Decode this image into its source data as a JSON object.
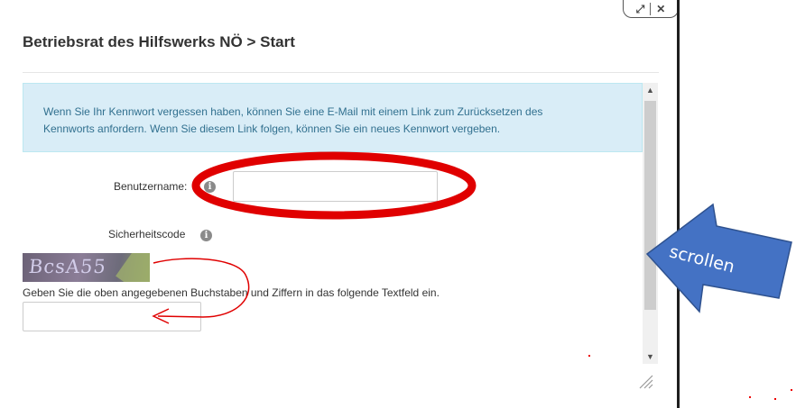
{
  "header": {
    "title": "Betriebsrat des Hilfswerks NÖ > Start",
    "controls": {
      "expand_icon": "⤢",
      "close_icon": "✕"
    }
  },
  "info": {
    "line1": "Wenn Sie Ihr Kennwort vergessen haben, können Sie eine E-Mail mit einem Link zum Zurücksetzen des",
    "line2": "Kennworts anfordern. Wenn Sie diesem Link folgen, können Sie ein neues Kennwort vergeben."
  },
  "form": {
    "username_label": "Benutzername:",
    "username_value": "",
    "security_label": "Sicherheitscode",
    "captcha_text": "BcsA55",
    "hint": "Geben Sie die oben angegebenen Buchstaben und Ziffern in das folgende Textfeld ein.",
    "code_value": "",
    "info_icon": "i"
  },
  "scrollbar": {
    "up_icon": "▲",
    "down_icon": "▼"
  },
  "annotation": {
    "arrow_text": "scrollen",
    "arrow_color": "#4472c4",
    "ellipse_color": "#e00000"
  }
}
